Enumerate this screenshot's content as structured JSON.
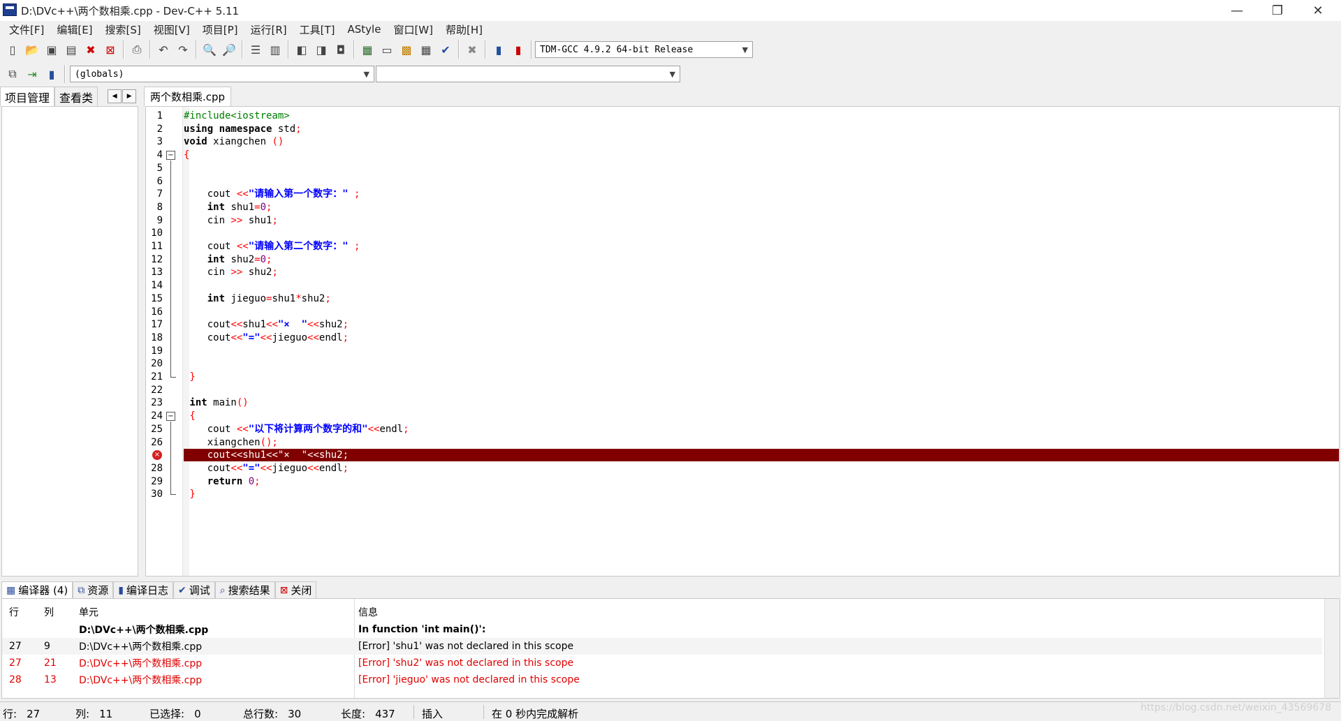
{
  "window": {
    "title": "D:\\DVc++\\两个数相乘.cpp - Dev-C++ 5.11",
    "minimize": "—",
    "maximize": "❐",
    "close": "✕"
  },
  "menu": [
    "文件[F]",
    "编辑[E]",
    "搜索[S]",
    "视图[V]",
    "项目[P]",
    "运行[R]",
    "工具[T]",
    "AStyle",
    "窗口[W]",
    "帮助[H]"
  ],
  "toolbar": {
    "compiler_select": "TDM-GCC 4.9.2 64-bit Release",
    "scope_select": "(globals)",
    "function_select": ""
  },
  "left_panel": {
    "tabs": [
      "项目管理",
      "查看类"
    ],
    "prev": "◀",
    "next": "▶"
  },
  "editor": {
    "file_tab": "两个数相乘.cpp",
    "error_line": 27,
    "lines": [
      [
        {
          "t": "#include<iostream>",
          "c": "pre"
        }
      ],
      [
        {
          "t": "using namespace",
          "c": "kw"
        },
        {
          "t": " std",
          "c": ""
        },
        {
          "t": ";",
          "c": "op"
        }
      ],
      [
        {
          "t": "void",
          "c": "kw"
        },
        {
          "t": " xiangchen ",
          "c": ""
        },
        {
          "t": "()",
          "c": "op"
        }
      ],
      [
        {
          "t": "{",
          "c": "op"
        }
      ],
      [],
      [],
      [
        {
          "t": "    cout ",
          "c": ""
        },
        {
          "t": "<<",
          "c": "op"
        },
        {
          "t": "\"请输入第一个数字：\"",
          "c": "str"
        },
        {
          "t": " ;",
          "c": "op"
        }
      ],
      [
        {
          "t": "    ",
          "c": ""
        },
        {
          "t": "int",
          "c": "kw"
        },
        {
          "t": " shu1",
          "c": ""
        },
        {
          "t": "=",
          "c": "op"
        },
        {
          "t": "0",
          "c": "num"
        },
        {
          "t": ";",
          "c": "op"
        }
      ],
      [
        {
          "t": "    cin ",
          "c": ""
        },
        {
          "t": ">>",
          "c": "op"
        },
        {
          "t": " shu1",
          "c": ""
        },
        {
          "t": ";",
          "c": "op"
        }
      ],
      [],
      [
        {
          "t": "    cout ",
          "c": ""
        },
        {
          "t": "<<",
          "c": "op"
        },
        {
          "t": "\"请输入第二个数字：\"",
          "c": "str"
        },
        {
          "t": " ;",
          "c": "op"
        }
      ],
      [
        {
          "t": "    ",
          "c": ""
        },
        {
          "t": "int",
          "c": "kw"
        },
        {
          "t": " shu2",
          "c": ""
        },
        {
          "t": "=",
          "c": "op"
        },
        {
          "t": "0",
          "c": "num"
        },
        {
          "t": ";",
          "c": "op"
        }
      ],
      [
        {
          "t": "    cin ",
          "c": ""
        },
        {
          "t": ">>",
          "c": "op"
        },
        {
          "t": " shu2",
          "c": ""
        },
        {
          "t": ";",
          "c": "op"
        }
      ],
      [],
      [
        {
          "t": "    ",
          "c": ""
        },
        {
          "t": "int",
          "c": "kw"
        },
        {
          "t": " jieguo",
          "c": ""
        },
        {
          "t": "=",
          "c": "op"
        },
        {
          "t": "shu1",
          "c": ""
        },
        {
          "t": "*",
          "c": "op"
        },
        {
          "t": "shu2",
          "c": ""
        },
        {
          "t": ";",
          "c": "op"
        }
      ],
      [],
      [
        {
          "t": "    cout",
          "c": ""
        },
        {
          "t": "<<",
          "c": "op"
        },
        {
          "t": "shu1",
          "c": ""
        },
        {
          "t": "<<",
          "c": "op"
        },
        {
          "t": "\"×  \"",
          "c": "str"
        },
        {
          "t": "<<",
          "c": "op"
        },
        {
          "t": "shu2",
          "c": ""
        },
        {
          "t": ";",
          "c": "op"
        }
      ],
      [
        {
          "t": "    cout",
          "c": ""
        },
        {
          "t": "<<",
          "c": "op"
        },
        {
          "t": "\"=\"",
          "c": "str"
        },
        {
          "t": "<<",
          "c": "op"
        },
        {
          "t": "jieguo",
          "c": ""
        },
        {
          "t": "<<",
          "c": "op"
        },
        {
          "t": "endl",
          "c": ""
        },
        {
          "t": ";",
          "c": "op"
        }
      ],
      [],
      [],
      [
        {
          "t": " }",
          "c": "op"
        }
      ],
      [],
      [
        {
          "t": " int",
          "c": "kw"
        },
        {
          "t": " main",
          "c": ""
        },
        {
          "t": "()",
          "c": "op"
        }
      ],
      [
        {
          "t": " {",
          "c": "op"
        }
      ],
      [
        {
          "t": "    cout ",
          "c": ""
        },
        {
          "t": "<<",
          "c": "op"
        },
        {
          "t": "\"以下将计算两个数字的和\"",
          "c": "str"
        },
        {
          "t": "<<",
          "c": "op"
        },
        {
          "t": "endl",
          "c": ""
        },
        {
          "t": ";",
          "c": "op"
        }
      ],
      [
        {
          "t": "    xiangchen",
          "c": ""
        },
        {
          "t": "();",
          "c": "op"
        }
      ],
      [
        {
          "t": "    cout",
          "c": ""
        },
        {
          "t": "<<",
          "c": "op"
        },
        {
          "t": "shu1",
          "c": ""
        },
        {
          "t": "<<",
          "c": "op"
        },
        {
          "t": "\"×  \"",
          "c": "str"
        },
        {
          "t": "<<",
          "c": "op"
        },
        {
          "t": "shu2",
          "c": ""
        },
        {
          "t": ";",
          "c": "op"
        }
      ],
      [
        {
          "t": "    cout",
          "c": ""
        },
        {
          "t": "<<",
          "c": "op"
        },
        {
          "t": "\"=\"",
          "c": "str"
        },
        {
          "t": "<<",
          "c": "op"
        },
        {
          "t": "jieguo",
          "c": ""
        },
        {
          "t": "<<",
          "c": "op"
        },
        {
          "t": "endl",
          "c": ""
        },
        {
          "t": ";",
          "c": "op"
        }
      ],
      [
        {
          "t": "    ",
          "c": ""
        },
        {
          "t": "return",
          "c": "kw"
        },
        {
          "t": " ",
          "c": ""
        },
        {
          "t": "0",
          "c": "num"
        },
        {
          "t": ";",
          "c": "op"
        }
      ],
      [
        {
          "t": " }",
          "c": "op"
        }
      ]
    ]
  },
  "bottom_tabs": [
    "编译器 (4)",
    "资源",
    "编译日志",
    "调试",
    "搜索结果",
    "关闭"
  ],
  "messages": {
    "headers": {
      "line": "行",
      "col": "列",
      "unit": "单元",
      "message": "信息"
    },
    "rows": [
      {
        "line": "",
        "col": "",
        "unit": "D:\\DVc++\\两个数相乘.cpp",
        "message": "In function 'int main()':",
        "style": "head"
      },
      {
        "line": "27",
        "col": "9",
        "unit": "D:\\DVc++\\两个数相乘.cpp",
        "message": "[Error] 'shu1' was not declared in this scope",
        "style": "alt"
      },
      {
        "line": "27",
        "col": "21",
        "unit": "D:\\DVc++\\两个数相乘.cpp",
        "message": "[Error] 'shu2' was not declared in this scope",
        "style": "red"
      },
      {
        "line": "28",
        "col": "13",
        "unit": "D:\\DVc++\\两个数相乘.cpp",
        "message": "[Error] 'jieguo' was not declared in this scope",
        "style": "red"
      }
    ]
  },
  "status": {
    "row_label": "行:",
    "row_value": "27",
    "col_label": "列:",
    "col_value": "11",
    "sel_label": "已选择:",
    "sel_value": "0",
    "total_label": "总行数:",
    "total_value": "30",
    "len_label": "长度:",
    "len_value": "437",
    "mode": "插入",
    "parse": "在 0 秒内完成解析"
  },
  "watermark": "https://blog.csdn.net/weixin_43569678"
}
